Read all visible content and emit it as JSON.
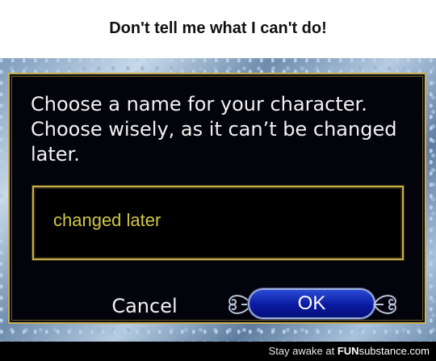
{
  "caption": {
    "text": "Don't tell me what I can't do!"
  },
  "dialog": {
    "message": "Choose a name for your character. Choose wisely, as it can’t be changed later.",
    "input_value": "changed later",
    "cancel_label": "Cancel",
    "ok_label": "OK"
  },
  "watermark": {
    "prefix": "Stay awake at ",
    "brand_fun": "FUN",
    "brand_rest": "substance.com"
  },
  "colors": {
    "panel_bg": "#03030c",
    "gold_border": "#c9ad4e",
    "input_text": "#d2c644",
    "ok_blue": "#0a1aa0"
  }
}
